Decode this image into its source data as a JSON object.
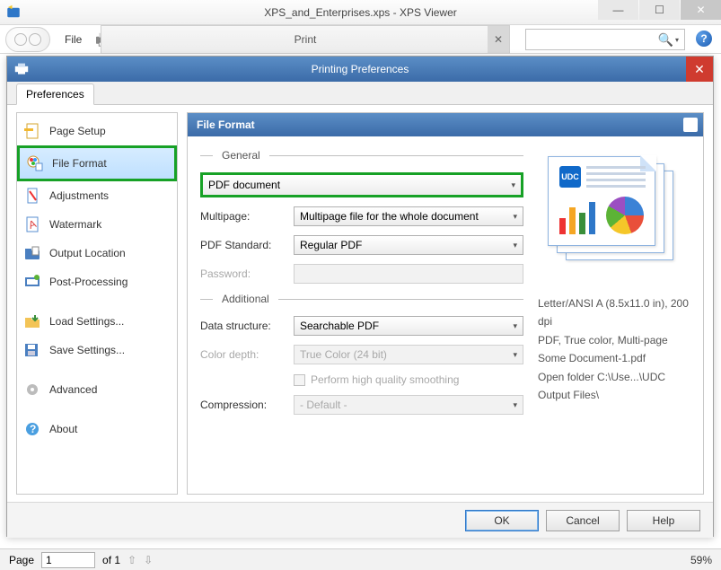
{
  "window": {
    "title": "XPS_and_Enterprises.xps - XPS Viewer",
    "file_menu": "File",
    "print_header": "Print"
  },
  "prefs": {
    "title": "Printing Preferences",
    "tab": "Preferences",
    "panel_title": "File Format",
    "sidebar": [
      {
        "label": "Page Setup"
      },
      {
        "label": "File Format"
      },
      {
        "label": "Adjustments"
      },
      {
        "label": "Watermark"
      },
      {
        "label": "Output Location"
      },
      {
        "label": "Post-Processing"
      },
      {
        "label": "Load Settings..."
      },
      {
        "label": "Save Settings..."
      },
      {
        "label": "Advanced"
      },
      {
        "label": "About"
      }
    ],
    "groups": {
      "general": "General",
      "additional": "Additional"
    },
    "labels": {
      "format": "PDF document",
      "multipage": "Multipage:",
      "multipage_val": "Multipage file for the whole document",
      "pdf_std": "PDF Standard:",
      "pdf_std_val": "Regular PDF",
      "password": "Password:",
      "data_struct": "Data structure:",
      "data_struct_val": "Searchable PDF",
      "color_depth": "Color depth:",
      "color_depth_val": "True Color (24 bit)",
      "smoothing": "Perform high quality smoothing",
      "compression": "Compression:",
      "compression_val": "- Default -"
    },
    "info": {
      "l1": "Letter/ANSI A (8.5x11.0 in), 200 dpi",
      "l2": "PDF, True color, Multi-page",
      "l3": "Some Document-1.pdf",
      "l4": "Open folder C:\\Use...\\UDC Output Files\\"
    },
    "buttons": {
      "ok": "OK",
      "cancel": "Cancel",
      "help": "Help"
    }
  },
  "status": {
    "page_label": "Page",
    "page_num": "1",
    "page_of": "of 1",
    "zoom": "59%"
  }
}
